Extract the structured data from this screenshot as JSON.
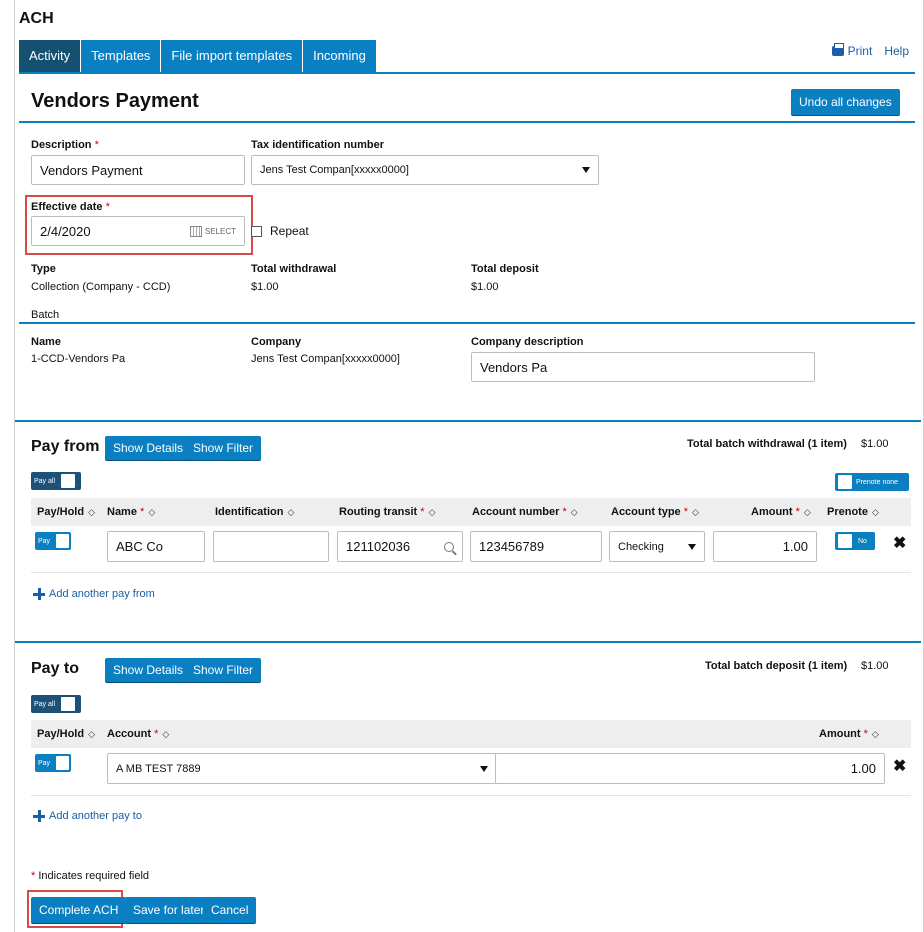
{
  "app_title": "ACH",
  "tabs": [
    "Activity",
    "Templates",
    "File import templates",
    "Incoming"
  ],
  "header_links": {
    "print": "Print",
    "help": "Help"
  },
  "page_title": "Vendors Payment",
  "undo_button": "Undo all changes",
  "form": {
    "description_label": "Description",
    "description_value": "Vendors Payment",
    "tax_id_label": "Tax identification number",
    "tax_id_value": "Jens Test Compan[xxxxx0000]",
    "effective_date_label": "Effective date",
    "effective_date_value": "2/4/2020",
    "select_label": "SELECT",
    "repeat_label": "Repeat",
    "type_label": "Type",
    "type_value": "Collection (Company - CCD)",
    "total_withdrawal_label": "Total withdrawal",
    "total_withdrawal_value": "$1.00",
    "total_deposit_label": "Total deposit",
    "total_deposit_value": "$1.00",
    "batch_label": "Batch",
    "name_label": "Name",
    "name_value": "1-CCD-Vendors Pa",
    "company_label": "Company",
    "company_value": "Jens Test Compan[xxxxx0000]",
    "company_desc_label": "Company description",
    "company_desc_value": "Vendors Pa"
  },
  "pay_from": {
    "title": "Pay from",
    "show_details": "Show Details",
    "show_filter": "Show Filter",
    "total_label": "Total batch withdrawal (1 item)",
    "total_value": "$1.00",
    "pay_all": "Pay all",
    "prenote_none": "Prenote none",
    "columns": [
      "Pay/Hold",
      "Name",
      "Identification",
      "Routing transit",
      "Account number",
      "Account type",
      "Amount",
      "Prenote"
    ],
    "row": {
      "pay": "Pay",
      "name": "ABC Co",
      "identification": "",
      "routing": "121102036",
      "account_number": "123456789",
      "account_type": "Checking",
      "amount": "1.00",
      "prenote": "No"
    },
    "add_link": "Add another pay from"
  },
  "pay_to": {
    "title": "Pay to",
    "show_details": "Show Details",
    "show_filter": "Show Filter",
    "total_label": "Total batch deposit (1 item)",
    "total_value": "$1.00",
    "pay_all": "Pay all",
    "columns": [
      "Pay/Hold",
      "Account",
      "Amount"
    ],
    "row": {
      "pay": "Pay",
      "account": "A MB TEST 7889",
      "amount": "1.00"
    },
    "add_link": "Add another pay to"
  },
  "footer": {
    "required_note": "Indicates required field",
    "complete": "Complete ACH",
    "save_later": "Save for later",
    "cancel": "Cancel"
  },
  "colors": {
    "accent": "#0a7fc1",
    "tab_active": "#14506f",
    "highlight": "#d64a4a"
  }
}
